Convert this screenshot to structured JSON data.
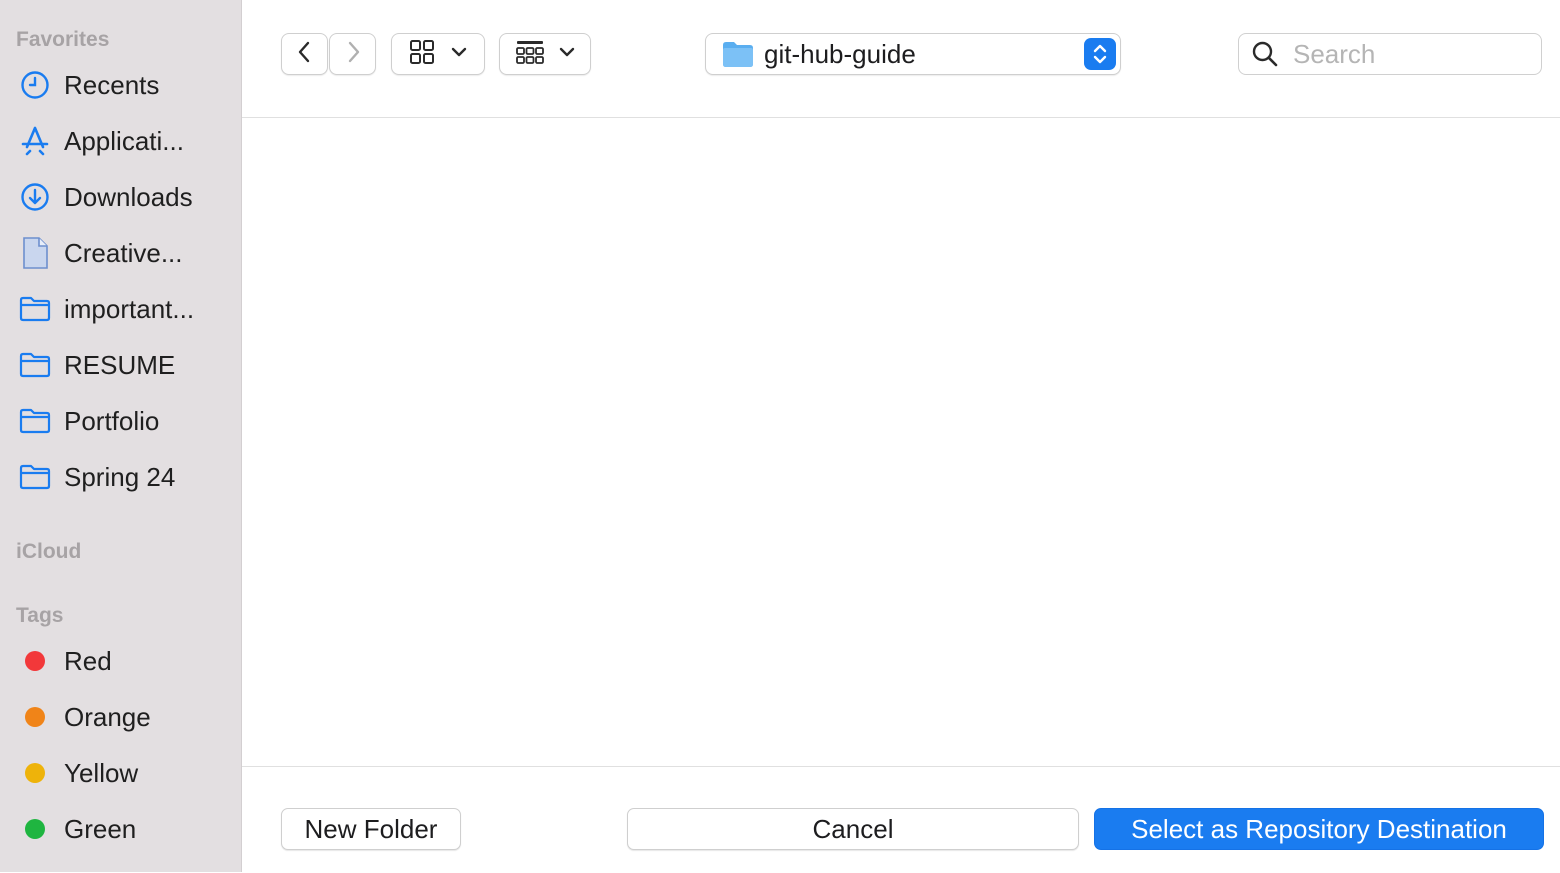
{
  "sidebar": {
    "favorites_title": "Favorites",
    "favorites": [
      {
        "label": "Recents",
        "icon": "clock-icon"
      },
      {
        "label": "Applicati...",
        "icon": "applications-icon"
      },
      {
        "label": "Downloads",
        "icon": "download-icon"
      },
      {
        "label": "Creative...",
        "icon": "document-icon"
      },
      {
        "label": "important...",
        "icon": "folder-icon"
      },
      {
        "label": "RESUME",
        "icon": "folder-icon"
      },
      {
        "label": "Portfolio",
        "icon": "folder-icon"
      },
      {
        "label": "Spring 24",
        "icon": "folder-icon"
      }
    ],
    "icloud_title": "iCloud",
    "tags_title": "Tags",
    "tags": [
      {
        "label": "Red",
        "color": "#f2383a"
      },
      {
        "label": "Orange",
        "color": "#f08418"
      },
      {
        "label": "Yellow",
        "color": "#eeb30a"
      },
      {
        "label": "Green",
        "color": "#1fb540"
      }
    ]
  },
  "toolbar": {
    "path_folder": "git-hub-guide",
    "search_placeholder": "Search"
  },
  "footer": {
    "new_folder_label": "New Folder",
    "cancel_label": "Cancel",
    "select_label": "Select as Repository Destination"
  },
  "colors": {
    "accent": "#1a7cf0",
    "sidebar_bg": "#e3dfe1"
  }
}
